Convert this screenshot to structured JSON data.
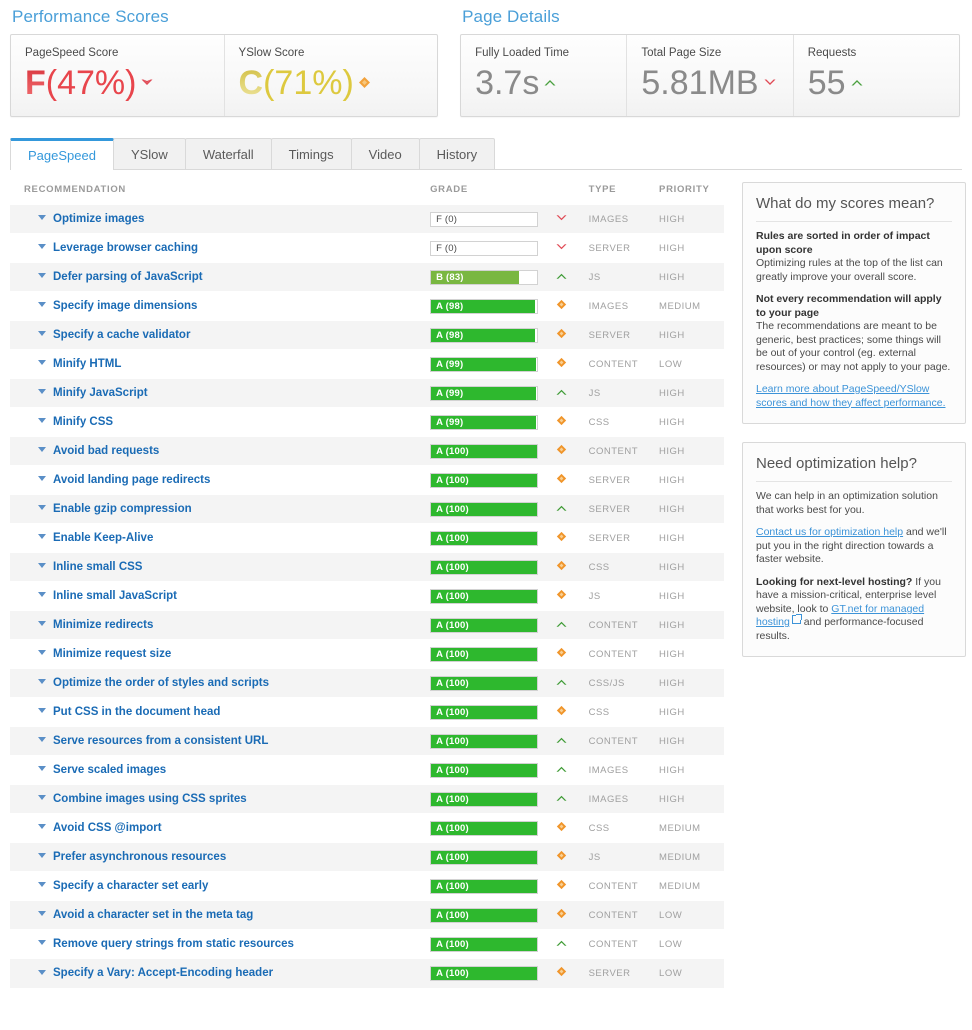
{
  "performance": {
    "title": "Performance Scores",
    "cards": [
      {
        "label": "PageSpeed Score",
        "letter": "F",
        "percent": "(47%)",
        "color": "#e8454c",
        "indicator": "chevron-down-red"
      },
      {
        "label": "YSlow Score",
        "letter": "C",
        "percent": "(71%)",
        "color": "#ddc93f",
        "indicator": "diamond-orange"
      }
    ]
  },
  "page_details": {
    "title": "Page Details",
    "cards": [
      {
        "label": "Fully Loaded Time",
        "value": "3.7s",
        "indicator": "chevron-up-green"
      },
      {
        "label": "Total Page Size",
        "value": "5.81MB",
        "indicator": "chevron-down-red"
      },
      {
        "label": "Requests",
        "value": "55",
        "indicator": "chevron-up-green"
      }
    ]
  },
  "tabs": [
    {
      "label": "PageSpeed",
      "active": true
    },
    {
      "label": "YSlow",
      "active": false
    },
    {
      "label": "Waterfall",
      "active": false
    },
    {
      "label": "Timings",
      "active": false
    },
    {
      "label": "Video",
      "active": false
    },
    {
      "label": "History",
      "active": false
    }
  ],
  "table": {
    "headers": {
      "recommendation": "RECOMMENDATION",
      "grade": "GRADE",
      "type": "TYPE",
      "priority": "PRIORITY"
    },
    "rows": [
      {
        "recommendation": "Optimize images",
        "grade": "F (0)",
        "score": 0,
        "letter": "F",
        "indicator": "chevron-down-red",
        "type": "IMAGES",
        "priority": "HIGH"
      },
      {
        "recommendation": "Leverage browser caching",
        "grade": "F (0)",
        "score": 0,
        "letter": "F",
        "indicator": "chevron-down-red",
        "type": "SERVER",
        "priority": "HIGH"
      },
      {
        "recommendation": "Defer parsing of JavaScript",
        "grade": "B (83)",
        "score": 83,
        "letter": "B",
        "indicator": "chevron-up-green",
        "type": "JS",
        "priority": "HIGH"
      },
      {
        "recommendation": "Specify image dimensions",
        "grade": "A (98)",
        "score": 98,
        "letter": "A",
        "indicator": "diamond-orange",
        "type": "IMAGES",
        "priority": "MEDIUM"
      },
      {
        "recommendation": "Specify a cache validator",
        "grade": "A (98)",
        "score": 98,
        "letter": "A",
        "indicator": "diamond-orange",
        "type": "SERVER",
        "priority": "HIGH"
      },
      {
        "recommendation": "Minify HTML",
        "grade": "A (99)",
        "score": 99,
        "letter": "A",
        "indicator": "diamond-orange",
        "type": "CONTENT",
        "priority": "LOW"
      },
      {
        "recommendation": "Minify JavaScript",
        "grade": "A (99)",
        "score": 99,
        "letter": "A",
        "indicator": "chevron-up-green",
        "type": "JS",
        "priority": "HIGH"
      },
      {
        "recommendation": "Minify CSS",
        "grade": "A (99)",
        "score": 99,
        "letter": "A",
        "indicator": "diamond-orange",
        "type": "CSS",
        "priority": "HIGH"
      },
      {
        "recommendation": "Avoid bad requests",
        "grade": "A (100)",
        "score": 100,
        "letter": "A",
        "indicator": "diamond-orange",
        "type": "CONTENT",
        "priority": "HIGH"
      },
      {
        "recommendation": "Avoid landing page redirects",
        "grade": "A (100)",
        "score": 100,
        "letter": "A",
        "indicator": "diamond-orange",
        "type": "SERVER",
        "priority": "HIGH"
      },
      {
        "recommendation": "Enable gzip compression",
        "grade": "A (100)",
        "score": 100,
        "letter": "A",
        "indicator": "chevron-up-green",
        "type": "SERVER",
        "priority": "HIGH"
      },
      {
        "recommendation": "Enable Keep-Alive",
        "grade": "A (100)",
        "score": 100,
        "letter": "A",
        "indicator": "diamond-orange",
        "type": "SERVER",
        "priority": "HIGH"
      },
      {
        "recommendation": "Inline small CSS",
        "grade": "A (100)",
        "score": 100,
        "letter": "A",
        "indicator": "diamond-orange",
        "type": "CSS",
        "priority": "HIGH"
      },
      {
        "recommendation": "Inline small JavaScript",
        "grade": "A (100)",
        "score": 100,
        "letter": "A",
        "indicator": "diamond-orange",
        "type": "JS",
        "priority": "HIGH"
      },
      {
        "recommendation": "Minimize redirects",
        "grade": "A (100)",
        "score": 100,
        "letter": "A",
        "indicator": "chevron-up-green",
        "type": "CONTENT",
        "priority": "HIGH"
      },
      {
        "recommendation": "Minimize request size",
        "grade": "A (100)",
        "score": 100,
        "letter": "A",
        "indicator": "diamond-orange",
        "type": "CONTENT",
        "priority": "HIGH"
      },
      {
        "recommendation": "Optimize the order of styles and scripts",
        "grade": "A (100)",
        "score": 100,
        "letter": "A",
        "indicator": "chevron-up-green",
        "type": "CSS/JS",
        "priority": "HIGH"
      },
      {
        "recommendation": "Put CSS in the document head",
        "grade": "A (100)",
        "score": 100,
        "letter": "A",
        "indicator": "diamond-orange",
        "type": "CSS",
        "priority": "HIGH"
      },
      {
        "recommendation": "Serve resources from a consistent URL",
        "grade": "A (100)",
        "score": 100,
        "letter": "A",
        "indicator": "chevron-up-green",
        "type": "CONTENT",
        "priority": "HIGH"
      },
      {
        "recommendation": "Serve scaled images",
        "grade": "A (100)",
        "score": 100,
        "letter": "A",
        "indicator": "chevron-up-green",
        "type": "IMAGES",
        "priority": "HIGH"
      },
      {
        "recommendation": "Combine images using CSS sprites",
        "grade": "A (100)",
        "score": 100,
        "letter": "A",
        "indicator": "chevron-up-green",
        "type": "IMAGES",
        "priority": "HIGH"
      },
      {
        "recommendation": "Avoid CSS @import",
        "grade": "A (100)",
        "score": 100,
        "letter": "A",
        "indicator": "diamond-orange",
        "type": "CSS",
        "priority": "MEDIUM"
      },
      {
        "recommendation": "Prefer asynchronous resources",
        "grade": "A (100)",
        "score": 100,
        "letter": "A",
        "indicator": "diamond-orange",
        "type": "JS",
        "priority": "MEDIUM"
      },
      {
        "recommendation": "Specify a character set early",
        "grade": "A (100)",
        "score": 100,
        "letter": "A",
        "indicator": "diamond-orange",
        "type": "CONTENT",
        "priority": "MEDIUM"
      },
      {
        "recommendation": "Avoid a character set in the meta tag",
        "grade": "A (100)",
        "score": 100,
        "letter": "A",
        "indicator": "diamond-orange",
        "type": "CONTENT",
        "priority": "LOW"
      },
      {
        "recommendation": "Remove query strings from static resources",
        "grade": "A (100)",
        "score": 100,
        "letter": "A",
        "indicator": "chevron-up-green",
        "type": "CONTENT",
        "priority": "LOW"
      },
      {
        "recommendation": "Specify a Vary: Accept-Encoding header",
        "grade": "A (100)",
        "score": 100,
        "letter": "A",
        "indicator": "diamond-orange",
        "type": "SERVER",
        "priority": "LOW"
      }
    ]
  },
  "sidebar": {
    "scores_panel": {
      "title": "What do my scores mean?",
      "heading1": "Rules are sorted in order of impact upon score",
      "body1": "Optimizing rules at the top of the list can greatly improve your overall score.",
      "heading2": "Not every recommendation will apply to your page",
      "body2": "The recommendations are meant to be generic, best practices; some things will be out of your control (eg. external resources) or may not apply to your page.",
      "link": "Learn more about PageSpeed/YSlow scores and how they affect performance."
    },
    "help_panel": {
      "title": "Need optimization help?",
      "body1": "We can help in an optimization solution that works best for you.",
      "link1": "Contact us for optimization help",
      "body2": " and we'll put you in the right direction towards a faster website.",
      "bold2": "Looking for next-level hosting?",
      "body3": " If you have a mission-critical, enterprise level website, look to ",
      "link2": "GT.net for managed hosting",
      "body4": " and performance-focused results."
    }
  },
  "colors": {
    "accent_blue": "#3498db",
    "link_blue": "#1a6bb5",
    "grade_a_green": "#2eb82e",
    "grade_b_green": "#79b741",
    "grade_f_red": "#e8454c",
    "diamond_orange": "#f0952a",
    "chevron_green": "#3f9b35"
  }
}
